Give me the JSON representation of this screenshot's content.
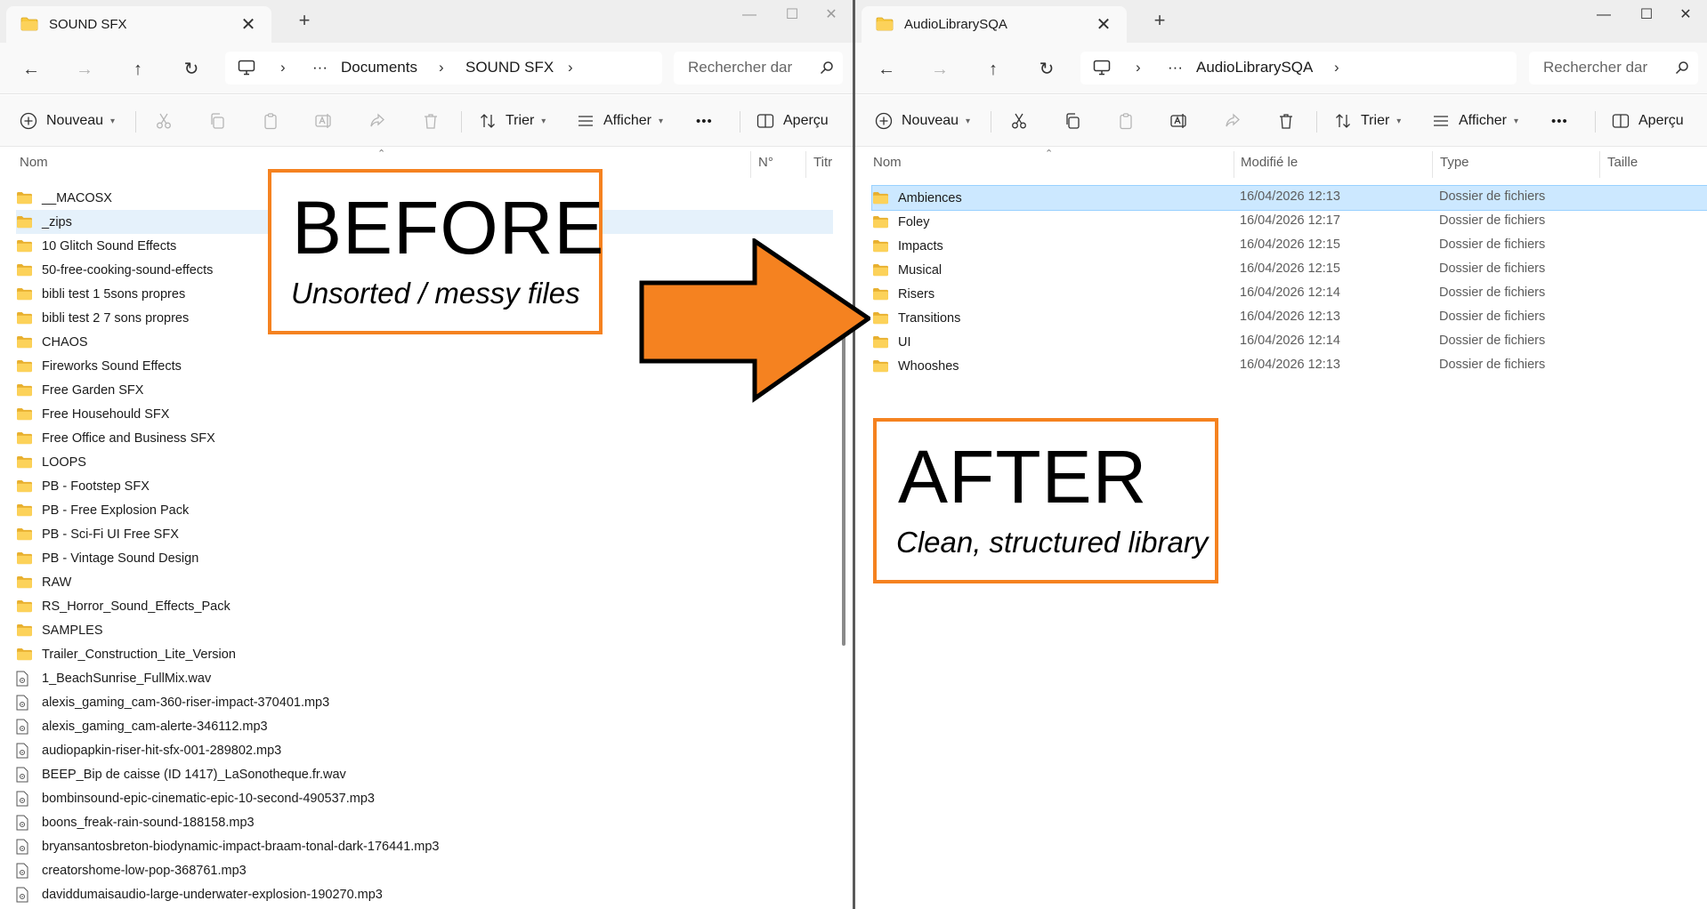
{
  "left": {
    "tab_title": "SOUND SFX",
    "address_items": [
      "Documents",
      "SOUND SFX"
    ],
    "search_placeholder": "Rechercher dar",
    "toolbar": {
      "new_label": "Nouveau",
      "sort_label": "Trier",
      "view_label": "Afficher",
      "more_label": "•••",
      "preview_label": "Aperçu"
    },
    "columns": {
      "name": "Nom",
      "number": "N°",
      "title": "Titr"
    },
    "items": [
      {
        "name": "__MACOSX",
        "kind": "folder"
      },
      {
        "name": "_zips",
        "kind": "folder"
      },
      {
        "name": "10 Glitch Sound Effects",
        "kind": "folder"
      },
      {
        "name": "50-free-cooking-sound-effects",
        "kind": "folder"
      },
      {
        "name": "bibli test 1 5sons propres",
        "kind": "folder"
      },
      {
        "name": "bibli test 2 7 sons propres",
        "kind": "folder"
      },
      {
        "name": "CHAOS",
        "kind": "folder"
      },
      {
        "name": "Fireworks Sound Effects",
        "kind": "folder"
      },
      {
        "name": "Free Garden SFX",
        "kind": "folder"
      },
      {
        "name": "Free Househould SFX",
        "kind": "folder"
      },
      {
        "name": "Free Office and Business SFX",
        "kind": "folder"
      },
      {
        "name": "LOOPS",
        "kind": "folder"
      },
      {
        "name": "PB - Footstep SFX",
        "kind": "folder"
      },
      {
        "name": "PB - Free Explosion Pack",
        "kind": "folder"
      },
      {
        "name": "PB - Sci-Fi UI Free SFX",
        "kind": "folder"
      },
      {
        "name": "PB - Vintage Sound Design",
        "kind": "folder"
      },
      {
        "name": "RAW",
        "kind": "folder"
      },
      {
        "name": "RS_Horror_Sound_Effects_Pack",
        "kind": "folder"
      },
      {
        "name": "SAMPLES",
        "kind": "folder"
      },
      {
        "name": "Trailer_Construction_Lite_Version",
        "kind": "folder"
      },
      {
        "name": "1_BeachSunrise_FullMix.wav",
        "kind": "file"
      },
      {
        "name": "alexis_gaming_cam-360-riser-impact-370401.mp3",
        "kind": "file"
      },
      {
        "name": "alexis_gaming_cam-alerte-346112.mp3",
        "kind": "file"
      },
      {
        "name": "audiopapkin-riser-hit-sfx-001-289802.mp3",
        "kind": "file"
      },
      {
        "name": "BEEP_Bip de caisse (ID 1417)_LaSonotheque.fr.wav",
        "kind": "file"
      },
      {
        "name": "bombinsound-epic-cinematic-epic-10-second-490537.mp3",
        "kind": "file"
      },
      {
        "name": "boons_freak-rain-sound-188158.mp3",
        "kind": "file"
      },
      {
        "name": "bryansantosbreton-biodynamic-impact-braam-tonal-dark-176441.mp3",
        "kind": "file"
      },
      {
        "name": "creatorshome-low-pop-368761.mp3",
        "kind": "file"
      },
      {
        "name": "daviddumaisaudio-large-underwater-explosion-190270.mp3",
        "kind": "file"
      }
    ]
  },
  "right": {
    "tab_title": "AudioLibrarySQA",
    "address_items": [
      "AudioLibrarySQA"
    ],
    "search_placeholder": "Rechercher dar",
    "toolbar": {
      "new_label": "Nouveau",
      "sort_label": "Trier",
      "view_label": "Afficher",
      "more_label": "•••",
      "preview_label": "Aperçu"
    },
    "columns": {
      "name": "Nom",
      "modified": "Modifié le",
      "type": "Type",
      "size": "Taille"
    },
    "items": [
      {
        "name": "Ambiences",
        "modified": "16/04/2026 12:13",
        "type": "Dossier de fichiers"
      },
      {
        "name": "Foley",
        "modified": "16/04/2026 12:17",
        "type": "Dossier de fichiers"
      },
      {
        "name": "Impacts",
        "modified": "16/04/2026 12:15",
        "type": "Dossier de fichiers"
      },
      {
        "name": "Musical",
        "modified": "16/04/2026 12:15",
        "type": "Dossier de fichiers"
      },
      {
        "name": "Risers",
        "modified": "16/04/2026 12:14",
        "type": "Dossier de fichiers"
      },
      {
        "name": "Transitions",
        "modified": "16/04/2026 12:13",
        "type": "Dossier de fichiers"
      },
      {
        "name": "UI",
        "modified": "16/04/2026 12:14",
        "type": "Dossier de fichiers"
      },
      {
        "name": "Whooshes",
        "modified": "16/04/2026 12:13",
        "type": "Dossier de fichiers"
      }
    ]
  },
  "callouts": {
    "before_title": "BEFORE",
    "before_subtitle": "Unsorted / messy files",
    "after_title": "AFTER",
    "after_subtitle": "Clean, structured library"
  },
  "colors": {
    "callout_border": "#f58220",
    "arrow_fill": "#f58220",
    "folder_yellow": "#f8c93e",
    "selection": "#cce8ff"
  },
  "icons": {
    "back": "arrow-left-icon",
    "forward": "arrow-right-icon",
    "up": "arrow-up-icon",
    "refresh": "refresh-icon",
    "pc": "monitor-icon",
    "search": "search-icon",
    "cut": "scissors-icon",
    "copy": "copy-icon",
    "paste": "clipboard-icon",
    "rename": "rename-icon",
    "share": "share-icon",
    "delete": "trash-icon",
    "folder": "folder-icon",
    "file": "audio-file-icon"
  }
}
